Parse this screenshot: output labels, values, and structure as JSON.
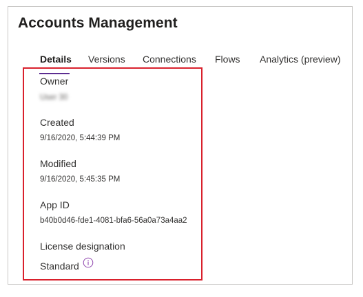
{
  "header": {
    "title": "Accounts Management"
  },
  "tabs": [
    {
      "label": "Details",
      "active": true
    },
    {
      "label": "Versions",
      "active": false
    },
    {
      "label": "Connections",
      "active": false
    },
    {
      "label": "Flows",
      "active": false
    },
    {
      "label": "Analytics (preview)",
      "active": false
    }
  ],
  "details": {
    "owner_label": "Owner",
    "owner_value": "User 30",
    "created_label": "Created",
    "created_value": "9/16/2020, 5:44:39 PM",
    "modified_label": "Modified",
    "modified_value": "9/16/2020, 5:45:35 PM",
    "app_id_label": "App ID",
    "app_id_value": "b40b0d46-fde1-4081-bfa6-56a0a73a4aa2",
    "license_label": "License designation",
    "license_value": "Standard"
  },
  "icons": {
    "info": "info-circle-icon"
  },
  "colors": {
    "tab_underline": "#5c2d91",
    "highlight_border": "#d9202c",
    "info_icon": "#8e44ad"
  }
}
